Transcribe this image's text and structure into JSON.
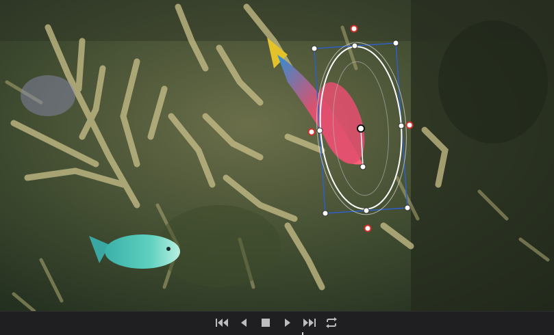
{
  "viewer": {
    "content": "underwater-coral-reef-footage",
    "mask_shape": "ellipse",
    "colors": {
      "mask_outline": "#ffffff",
      "bounding_box": "#2f5fc8",
      "softness_handle": "#d0302a",
      "control_point": "#ffffff"
    }
  },
  "transport": {
    "buttons": [
      {
        "name": "skip-to-start-icon"
      },
      {
        "name": "step-back-icon"
      },
      {
        "name": "stop-icon"
      },
      {
        "name": "play-icon"
      },
      {
        "name": "skip-to-end-icon"
      },
      {
        "name": "loop-icon"
      }
    ],
    "colors": {
      "icon": "#bdbdbd",
      "bar": "#1f1f21"
    }
  }
}
